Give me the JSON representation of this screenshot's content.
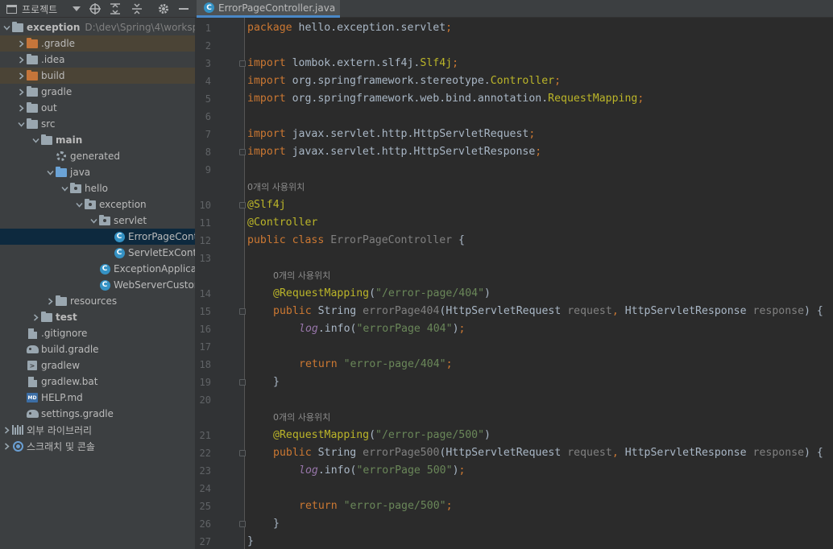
{
  "window": {
    "panel_title": "프로젝트",
    "toolbar_buttons": [
      "chevron-down-icon",
      "crosshair-icon",
      "expand-all-icon",
      "collapse-all-icon",
      "gear-icon",
      "minimize-icon"
    ]
  },
  "tree": [
    {
      "label": "exception",
      "path": "D:\\dev\\Spring\\4\\worksp",
      "bold": true,
      "icon": "module-folder",
      "depth": 0,
      "expanded": true
    },
    {
      "label": ".gradle",
      "icon": "folder-orange",
      "depth": 1,
      "expanded": false,
      "excluded": true
    },
    {
      "label": ".idea",
      "icon": "folder",
      "depth": 1,
      "expanded": false
    },
    {
      "label": "build",
      "icon": "folder-orange",
      "depth": 1,
      "expanded": false,
      "excluded": true
    },
    {
      "label": "gradle",
      "icon": "folder",
      "depth": 1,
      "expanded": false
    },
    {
      "label": "out",
      "icon": "folder",
      "depth": 1,
      "expanded": false
    },
    {
      "label": "src",
      "icon": "folder",
      "depth": 1,
      "expanded": true
    },
    {
      "label": "main",
      "bold": true,
      "icon": "folder",
      "depth": 2,
      "expanded": true
    },
    {
      "label": "generated",
      "icon": "gear-folder",
      "depth": 3,
      "leaf": true
    },
    {
      "label": "java",
      "icon": "folder-blue",
      "depth": 3,
      "expanded": true
    },
    {
      "label": "hello",
      "icon": "package",
      "depth": 4,
      "expanded": true
    },
    {
      "label": "exception",
      "icon": "package",
      "depth": 5,
      "expanded": true
    },
    {
      "label": "servlet",
      "icon": "package",
      "depth": 6,
      "expanded": true
    },
    {
      "label": "ErrorPageCont",
      "icon": "class",
      "depth": 7,
      "leaf": true,
      "selected": true
    },
    {
      "label": "ServletExContr",
      "icon": "class",
      "depth": 7,
      "leaf": true
    },
    {
      "label": "ExceptionApplicat",
      "icon": "class-run",
      "depth": 6,
      "leaf": true
    },
    {
      "label": "WebServerCustom",
      "icon": "class",
      "depth": 6,
      "leaf": true
    },
    {
      "label": "resources",
      "icon": "folder",
      "depth": 3,
      "expanded": false
    },
    {
      "label": "test",
      "bold": true,
      "icon": "folder",
      "depth": 2,
      "expanded": false
    },
    {
      "label": ".gitignore",
      "icon": "file",
      "depth": 1,
      "leaf": true
    },
    {
      "label": "build.gradle",
      "icon": "gradle",
      "depth": 1,
      "leaf": true
    },
    {
      "label": "gradlew",
      "icon": "terminal",
      "depth": 1,
      "leaf": true
    },
    {
      "label": "gradlew.bat",
      "icon": "file",
      "depth": 1,
      "leaf": true
    },
    {
      "label": "HELP.md",
      "icon": "md",
      "depth": 1,
      "leaf": true
    },
    {
      "label": "settings.gradle",
      "icon": "gradle",
      "depth": 1,
      "leaf": true
    },
    {
      "label": "외부 라이브러리",
      "icon": "library",
      "depth": 0,
      "expanded": false
    },
    {
      "label": "스크래치 및 콘솔",
      "icon": "scratch",
      "depth": 0,
      "expanded": false
    }
  ],
  "editor": {
    "tab_label": "ErrorPageController.java",
    "usage_hint": "0개의 사용위치",
    "lines": [
      {
        "n": "1",
        "tokens": [
          [
            "kw",
            "package"
          ],
          [
            "cn",
            " hello.exception.servlet"
          ],
          [
            "pu",
            ";"
          ]
        ]
      },
      {
        "n": "2",
        "tokens": []
      },
      {
        "n": "3",
        "tokens": [
          [
            "kw",
            "import"
          ],
          [
            "cn",
            " lombok.extern.slf4j."
          ],
          [
            "ty",
            "Slf4j"
          ],
          [
            "pu",
            ";"
          ]
        ],
        "fold": true
      },
      {
        "n": "4",
        "tokens": [
          [
            "kw",
            "import"
          ],
          [
            "cn",
            " org.springframework.stereotype."
          ],
          [
            "ty",
            "Controller"
          ],
          [
            "pu",
            ";"
          ]
        ]
      },
      {
        "n": "5",
        "tokens": [
          [
            "kw",
            "import"
          ],
          [
            "cn",
            " org.springframework.web.bind.annotation."
          ],
          [
            "ty",
            "RequestMapping"
          ],
          [
            "pu",
            ";"
          ]
        ]
      },
      {
        "n": "6",
        "tokens": []
      },
      {
        "n": "7",
        "tokens": [
          [
            "kw",
            "import"
          ],
          [
            "cn",
            " javax.servlet.http.HttpServletRequest"
          ],
          [
            "pu",
            ";"
          ]
        ]
      },
      {
        "n": "8",
        "tokens": [
          [
            "kw",
            "import"
          ],
          [
            "cn",
            " javax.servlet.http.HttpServletResponse"
          ],
          [
            "pu",
            ";"
          ]
        ],
        "fold": true
      },
      {
        "n": "9",
        "tokens": []
      },
      {
        "hint": true
      },
      {
        "n": "10",
        "tokens": [
          [
            "an",
            "@Slf4j"
          ]
        ],
        "fold": true
      },
      {
        "n": "11",
        "tokens": [
          [
            "an",
            "@Controller"
          ]
        ]
      },
      {
        "n": "12",
        "tokens": [
          [
            "kw",
            "public class "
          ],
          [
            "gr",
            "ErrorPageController"
          ],
          [
            "cn",
            " {"
          ]
        ]
      },
      {
        "n": "13",
        "tokens": []
      },
      {
        "hint": true,
        "indent": 1
      },
      {
        "n": "14",
        "indent": 1,
        "tokens": [
          [
            "an",
            "@RequestMapping"
          ],
          [
            "cn",
            "("
          ],
          [
            "st",
            "\"/error-page/404\""
          ],
          [
            "cn",
            ")"
          ]
        ]
      },
      {
        "n": "15",
        "indent": 1,
        "tokens": [
          [
            "kw",
            "public "
          ],
          [
            "cn",
            "String "
          ],
          [
            "gr",
            "errorPage404"
          ],
          [
            "cn",
            "(HttpServletRequest "
          ],
          [
            "un",
            "request"
          ],
          [
            "pu",
            ", "
          ],
          [
            "cn",
            "HttpServletResponse "
          ],
          [
            "un",
            "response"
          ],
          [
            "cn",
            ") {"
          ]
        ],
        "fold": true
      },
      {
        "n": "16",
        "indent": 2,
        "tokens": [
          [
            "fd",
            "log"
          ],
          [
            "cn",
            ".info("
          ],
          [
            "st",
            "\"errorPage 404\""
          ],
          [
            "cn",
            ")"
          ],
          [
            "pu",
            ";"
          ]
        ]
      },
      {
        "n": "17",
        "tokens": []
      },
      {
        "n": "18",
        "indent": 2,
        "tokens": [
          [
            "kw",
            "return "
          ],
          [
            "st",
            "\"error-page/404\""
          ],
          [
            "pu",
            ";"
          ]
        ]
      },
      {
        "n": "19",
        "indent": 1,
        "tokens": [
          [
            "cn",
            "}"
          ]
        ],
        "fold": true
      },
      {
        "n": "20",
        "tokens": []
      },
      {
        "hint": true,
        "indent": 1
      },
      {
        "n": "21",
        "indent": 1,
        "tokens": [
          [
            "an",
            "@RequestMapping"
          ],
          [
            "cn",
            "("
          ],
          [
            "st",
            "\"/error-page/500\""
          ],
          [
            "cn",
            ")"
          ]
        ]
      },
      {
        "n": "22",
        "indent": 1,
        "tokens": [
          [
            "kw",
            "public "
          ],
          [
            "cn",
            "String "
          ],
          [
            "gr",
            "errorPage500"
          ],
          [
            "cn",
            "(HttpServletRequest "
          ],
          [
            "un",
            "request"
          ],
          [
            "pu",
            ", "
          ],
          [
            "cn",
            "HttpServletResponse "
          ],
          [
            "un",
            "response"
          ],
          [
            "cn",
            ") {"
          ]
        ],
        "fold": true
      },
      {
        "n": "23",
        "indent": 2,
        "tokens": [
          [
            "fd",
            "log"
          ],
          [
            "cn",
            ".info("
          ],
          [
            "st",
            "\"errorPage 500\""
          ],
          [
            "cn",
            ")"
          ],
          [
            "pu",
            ";"
          ]
        ]
      },
      {
        "n": "24",
        "tokens": []
      },
      {
        "n": "25",
        "indent": 2,
        "tokens": [
          [
            "kw",
            "return "
          ],
          [
            "st",
            "\"error-page/500\""
          ],
          [
            "pu",
            ";"
          ]
        ]
      },
      {
        "n": "26",
        "indent": 1,
        "tokens": [
          [
            "cn",
            "}"
          ]
        ],
        "fold": true
      },
      {
        "n": "27",
        "tokens": [
          [
            "cn",
            "}"
          ]
        ]
      }
    ]
  }
}
